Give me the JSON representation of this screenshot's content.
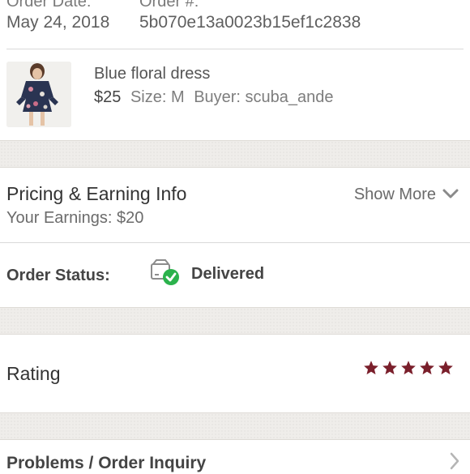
{
  "order": {
    "date_label": "Order Date:",
    "date_value": "May 24, 2018",
    "number_label": "Order #:",
    "number_value": "5b070e13a0023b15ef1c2838"
  },
  "item": {
    "title": "Blue floral dress",
    "price": "$25",
    "size": "Size: M",
    "buyer": "Buyer: scuba_ande"
  },
  "pricing": {
    "title": "Pricing & Earning Info",
    "earnings": "Your Earnings: $20",
    "show_more": "Show More"
  },
  "status": {
    "label": "Order Status:",
    "value": "Delivered",
    "icon": "delivered-box-icon",
    "check_color": "#2bb24c"
  },
  "rating": {
    "label": "Rating",
    "stars": 5,
    "star_color": "#7a1f2b"
  },
  "problems": {
    "label": "Problems / Order Inquiry"
  }
}
